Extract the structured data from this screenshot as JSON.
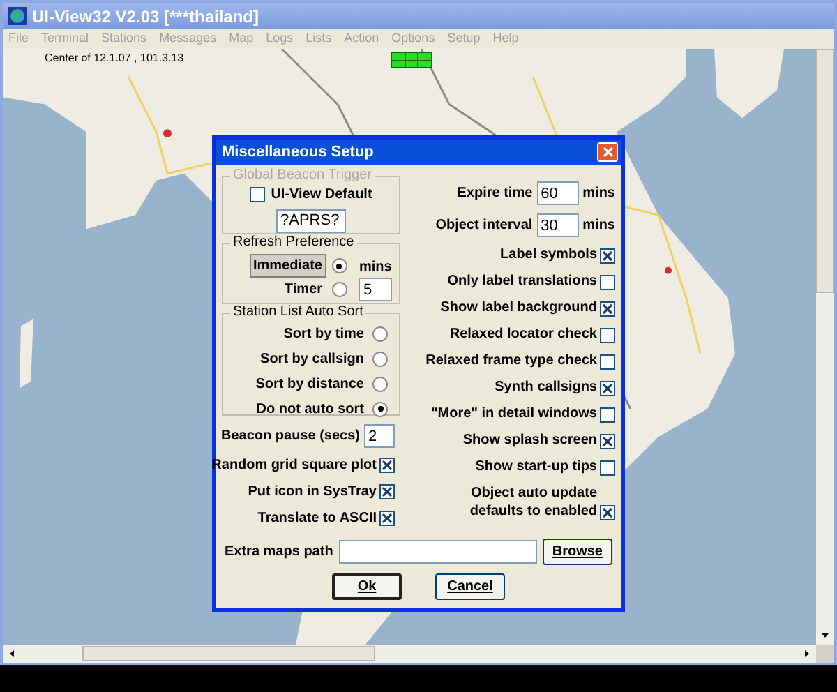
{
  "window": {
    "title": "UI-View32 V2.03 [***thailand]"
  },
  "menu": [
    {
      "label": "File"
    },
    {
      "label": "Terminal"
    },
    {
      "label": "Stations"
    },
    {
      "label": "Messages"
    },
    {
      "label": "Map"
    },
    {
      "label": "Logs"
    },
    {
      "label": "Lists"
    },
    {
      "label": "Action"
    },
    {
      "label": "Options"
    },
    {
      "label": "Setup"
    },
    {
      "label": "Help"
    }
  ],
  "map": {
    "kind": "picture",
    "center_label": "Center of 12.1.07 , 101.3.13"
  },
  "dialog": {
    "title": "Miscellaneous Setup",
    "global_beacon_trigger": {
      "legend": "Global Beacon Trigger",
      "disabled": true,
      "checkbox": {
        "label": "UI-View Default",
        "checked": false
      },
      "value": "?APRS?"
    },
    "refresh_preference": {
      "legend": "Refresh Preference",
      "options": [
        {
          "label": "Immediate",
          "selected": true,
          "focused": true
        },
        {
          "label": "Timer",
          "selected": false,
          "focused": false
        }
      ],
      "unit": "mins",
      "value": "5"
    },
    "station_list_auto_sort": {
      "legend": "Station List Auto Sort",
      "options": [
        {
          "label": "Sort by time",
          "selected": false
        },
        {
          "label": "Sort by callsign",
          "selected": false
        },
        {
          "label": "Sort by distance",
          "selected": false
        },
        {
          "label": "Do not auto sort",
          "selected": true
        }
      ]
    },
    "beacon_pause": {
      "label": "Beacon pause (secs)",
      "value": "2"
    },
    "left_checkboxes": [
      {
        "label": "Random grid square plot",
        "checked": true
      },
      {
        "label": "Put icon in SysTray",
        "checked": true
      },
      {
        "label": "Translate to ASCII",
        "checked": true
      }
    ],
    "fields": [
      {
        "label": "Expire time",
        "value": "60",
        "unit": "mins"
      },
      {
        "label": "Object interval",
        "value": "30",
        "unit": "mins"
      }
    ],
    "right_checkboxes": [
      {
        "label": "Label symbols",
        "checked": true
      },
      {
        "label": "Only label translations",
        "checked": false
      },
      {
        "label": "Show label background",
        "checked": true
      },
      {
        "label": "Relaxed locator check",
        "checked": false
      },
      {
        "label": "Relaxed frame type check",
        "checked": false
      },
      {
        "label": "Synth callsigns",
        "checked": true
      },
      {
        "label": "\"More\" in detail windows",
        "checked": false
      },
      {
        "label": "Show splash screen",
        "checked": true
      },
      {
        "label": "Show start-up tips",
        "checked": false
      },
      {
        "label": "Object auto update\ndefaults to enabled",
        "checked": true
      }
    ],
    "maps_path": {
      "label": "Extra maps path",
      "button": "Browse"
    },
    "buttons": [
      {
        "label": "Ok"
      },
      {
        "label": "Cancel"
      }
    ]
  }
}
